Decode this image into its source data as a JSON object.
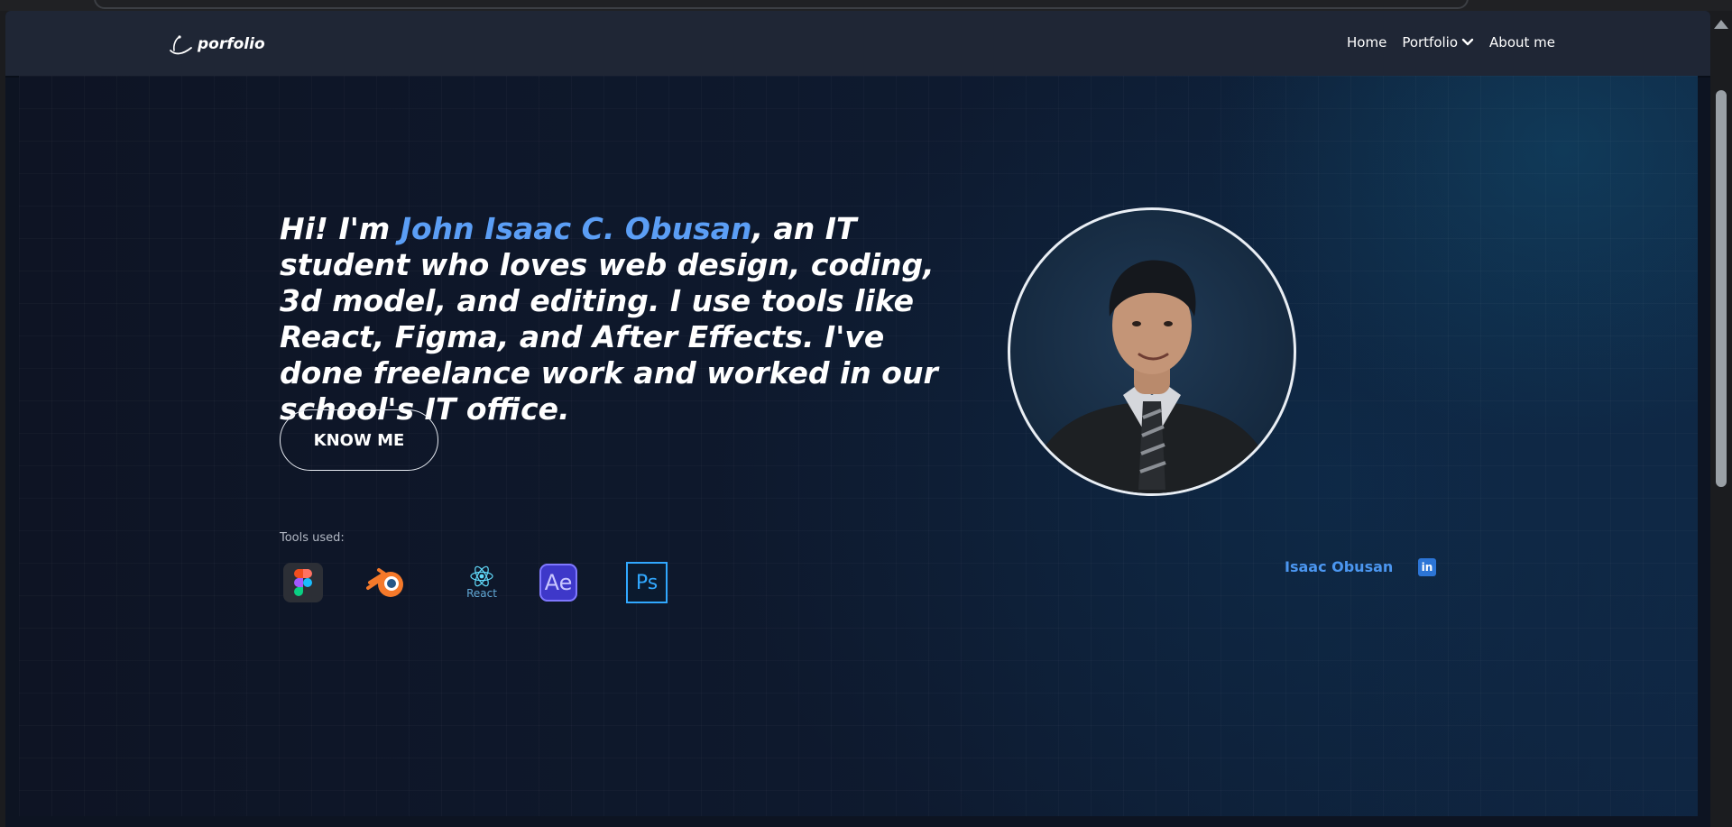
{
  "brand": {
    "name": "porfolio",
    "logo_icon": "bird-swoosh-icon"
  },
  "nav": {
    "home": "Home",
    "portfolio": "Portfolio",
    "portfolio_icon": "chevron-down-icon",
    "about": "About me"
  },
  "hero": {
    "intro_prefix": "Hi! I'm ",
    "name": "John Isaac C. Obusan",
    "intro_suffix": ", an IT student who loves web design, coding, 3d model, and editing. I use tools like React, Figma, and After Effects. I've done freelance work and worked in our school's IT office.",
    "cta": "KNOW ME",
    "accent_color": "#5b9ef5"
  },
  "tools": {
    "label": "Tools used:",
    "items": [
      {
        "name": "figma-icon"
      },
      {
        "name": "blender-icon"
      },
      {
        "name": "react-icon",
        "caption": "React"
      },
      {
        "name": "after-effects-icon",
        "caption": "Ae"
      },
      {
        "name": "photoshop-icon",
        "caption": "Ps"
      }
    ]
  },
  "profile": {
    "photo": "profile-photo"
  },
  "social": {
    "name": "Isaac Obusan",
    "linkedin_label": "in",
    "linkedin_icon": "linkedin-icon"
  }
}
